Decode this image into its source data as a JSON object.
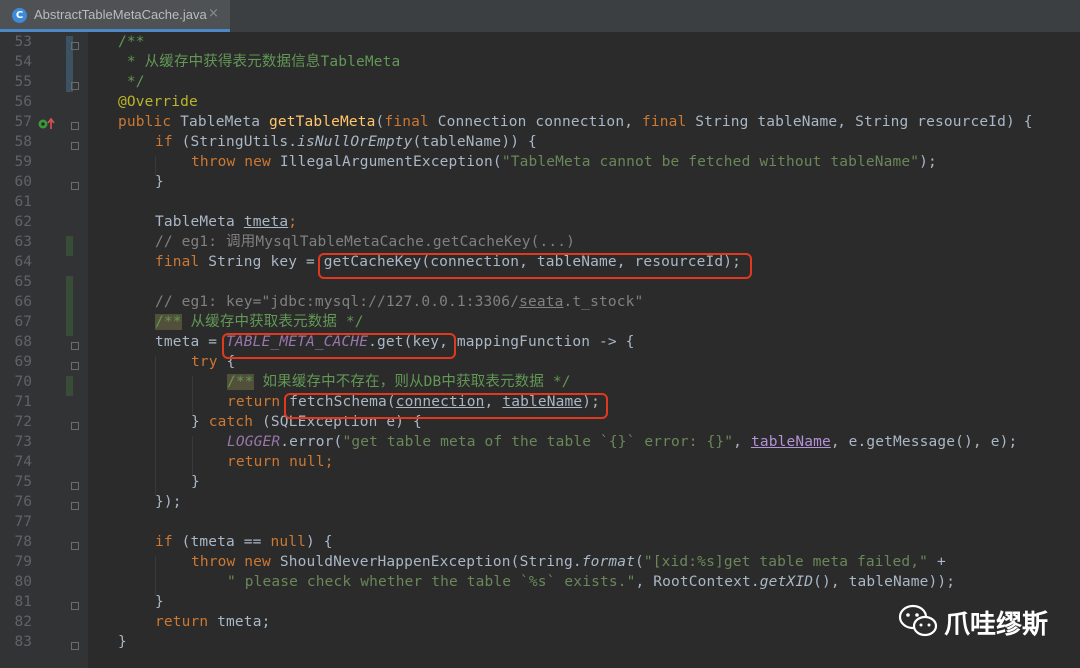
{
  "tab": {
    "icon_letter": "C",
    "label": "AbstractTableMetaCache.java",
    "close": "×"
  },
  "line_numbers": [
    "53",
    "54",
    "55",
    "56",
    "57",
    "58",
    "59",
    "60",
    "61",
    "62",
    "63",
    "64",
    "65",
    "66",
    "67",
    "68",
    "69",
    "70",
    "71",
    "72",
    "73",
    "74",
    "75",
    "76",
    "77",
    "78",
    "79",
    "80",
    "81",
    "82",
    "83"
  ],
  "code": {
    "l53": "/**",
    "l54": " * 从缓存中获得表元数据信息TableMeta",
    "l55": " */",
    "l56": "@Override",
    "l57": [
      "public ",
      "TableMeta ",
      "getTableMeta",
      "(",
      "final ",
      "Connection connection, ",
      "final ",
      "String tableName, String resourceId) {"
    ],
    "l58": [
      "if ",
      "(StringUtils.",
      "isNullOrEmpty",
      "(tableName)) {"
    ],
    "l59": [
      "throw new ",
      "IllegalArgumentException(",
      "\"TableMeta cannot be fetched without tableName\"",
      ");"
    ],
    "l60": "}",
    "l62": [
      "TableMeta ",
      "tmeta",
      ";"
    ],
    "l63": "// eg1: 调用MysqlTableMetaCache.getCacheKey(...)",
    "l64": [
      "final ",
      "String key = ",
      "getCacheKey(connection, tableName, resourceId);"
    ],
    "l66": [
      "// eg1: key=\"jdbc:mysql://127.0.0.1:3306/",
      "seata",
      ".t_stock\""
    ],
    "l67": [
      "/**",
      " 从缓存中获取表元数据 */"
    ],
    "l68": [
      "tmeta = ",
      "TABLE_META_CACHE",
      ".get(key, mappingFunction -> {"
    ],
    "l69": [
      "try ",
      "{"
    ],
    "l70": [
      "/**",
      " 如果缓存中不存在，则从DB中获取表元数据 */"
    ],
    "l71": [
      "return ",
      "fetchSchema(",
      "connection",
      ", ",
      "tableName",
      ");"
    ],
    "l72": [
      "} ",
      "catch ",
      "(SQLException e) {"
    ],
    "l73": [
      "LOGGER",
      ".error(",
      "\"get table meta of the table `{}` error: {}\"",
      ", ",
      "tableName",
      ", e.getMessage(), e);"
    ],
    "l74": [
      "return null",
      ";"
    ],
    "l75": "}",
    "l76": "});",
    "l78": [
      "if ",
      "(tmeta == ",
      "null",
      ") {"
    ],
    "l79": [
      "throw new ",
      "ShouldNeverHappenException(String.",
      "format",
      "(",
      "\"[xid:%s]get table meta failed,\"",
      " +"
    ],
    "l80": [
      "\" please check whether the table `%s` exists.\"",
      ", RootContext.",
      "getXID",
      "(), tableName));"
    ],
    "l81": "}",
    "l82": [
      "return ",
      "tmeta;"
    ],
    "l83": "}"
  },
  "watermark": {
    "text": "爪哇缪斯",
    "icon": "wechat-icon"
  },
  "colors": {
    "keyword": "#cc7832",
    "string": "#6a8759",
    "comment": "#808080",
    "doc": "#629755",
    "method": "#ffc66d",
    "static": "#9876aa",
    "highlight_box": "#e0391f"
  }
}
